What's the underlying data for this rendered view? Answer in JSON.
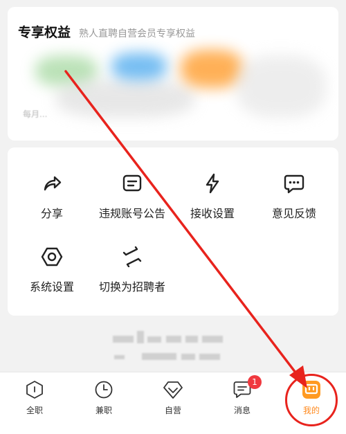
{
  "benefits": {
    "title": "专享权益",
    "subtitle": "熟人直聘自营会员专享权益",
    "footer_fragment": "每月..."
  },
  "settings": {
    "items": [
      {
        "label": "分享",
        "icon": "share-icon"
      },
      {
        "label": "违规账号公告",
        "icon": "notice-icon"
      },
      {
        "label": "接收设置",
        "icon": "lightning-icon"
      },
      {
        "label": "意见反馈",
        "icon": "feedback-icon"
      },
      {
        "label": "系统设置",
        "icon": "settings-hex-icon"
      },
      {
        "label": "切换为招聘者",
        "icon": "switch-arrows-icon"
      }
    ]
  },
  "tabbar": {
    "tabs": [
      {
        "label": "全职",
        "icon": "fulltime-icon"
      },
      {
        "label": "兼职",
        "icon": "clock-icon"
      },
      {
        "label": "自营",
        "icon": "diamond-icon"
      },
      {
        "label": "消息",
        "icon": "message-icon",
        "badge": "1"
      },
      {
        "label": "我的",
        "icon": "profile-icon",
        "active": true
      }
    ]
  },
  "colors": {
    "accent": "#ff8a1f",
    "badge": "#f0393f",
    "annotation": "#e8231d"
  }
}
